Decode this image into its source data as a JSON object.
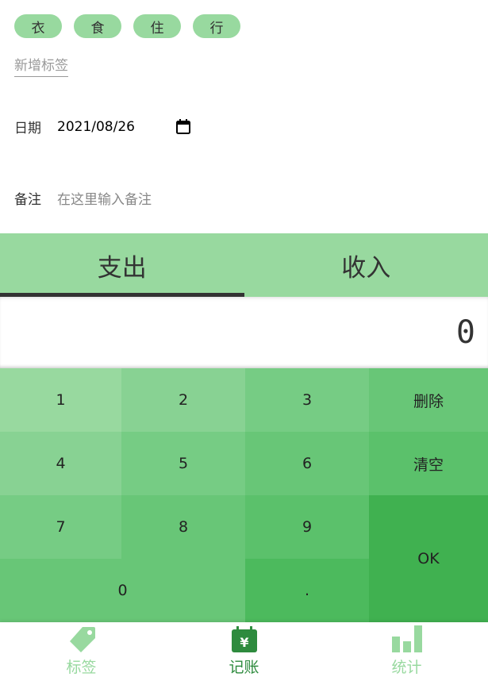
{
  "tags": [
    "衣",
    "食",
    "住",
    "行"
  ],
  "new_tag_label": "新增标签",
  "date": {
    "label": "日期",
    "value": "2021/08/26"
  },
  "note": {
    "label": "备注",
    "placeholder": "在这里输入备注"
  },
  "type_tabs": [
    {
      "label": "支出",
      "selected": true
    },
    {
      "label": "收入",
      "selected": false
    }
  ],
  "output": "0",
  "keypad": {
    "k1": "1",
    "k2": "2",
    "k3": "3",
    "delete": "删除",
    "k4": "4",
    "k5": "5",
    "k6": "6",
    "clear": "清空",
    "k7": "7",
    "k8": "8",
    "k9": "9",
    "ok": "OK",
    "k0": "0",
    "dot": "."
  },
  "nav": [
    {
      "label": "标签",
      "icon": "tag-icon",
      "active": false
    },
    {
      "label": "记账",
      "icon": "money-icon",
      "active": true
    },
    {
      "label": "统计",
      "icon": "chart-icon",
      "active": false
    }
  ],
  "colors": {
    "accent": "#98d99f",
    "active_nav": "#2e8b3e",
    "ok_key": "#40b150"
  }
}
